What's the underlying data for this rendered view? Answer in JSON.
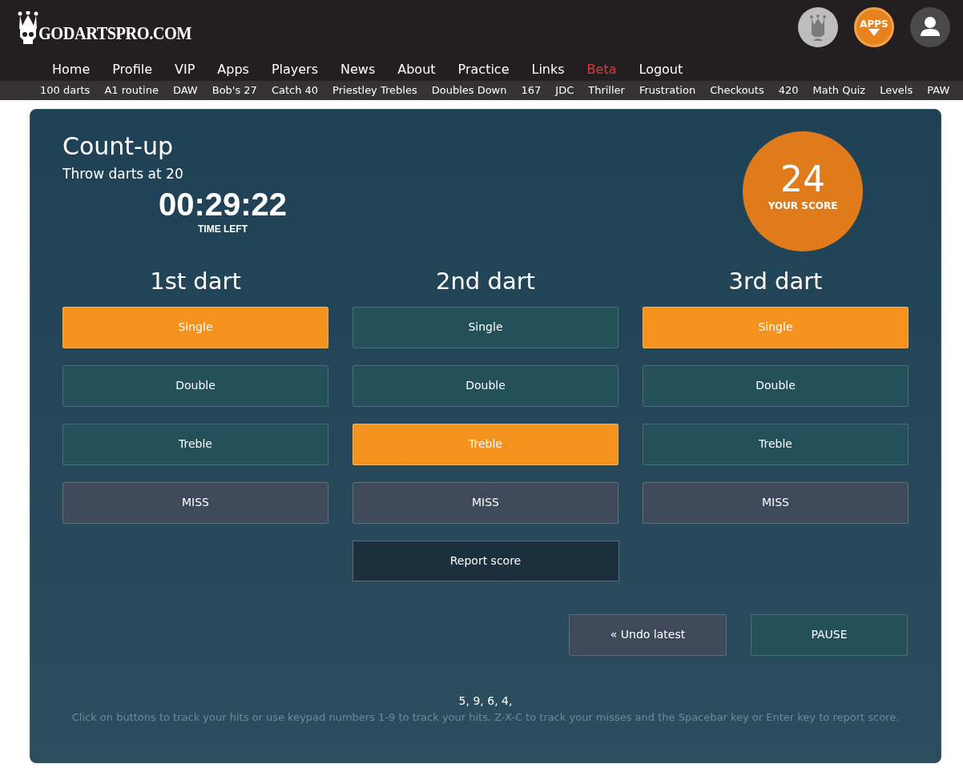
{
  "logo": {
    "text": "GODARTSPRO.COM"
  },
  "nav": [
    {
      "label": "Home",
      "color": "#ffffff"
    },
    {
      "label": "Profile",
      "color": "#ffffff"
    },
    {
      "label": "VIP",
      "color": "#ffffff"
    },
    {
      "label": "Apps",
      "color": "#ffffff"
    },
    {
      "label": "Players",
      "color": "#ffffff"
    },
    {
      "label": "News",
      "color": "#ffffff"
    },
    {
      "label": "About",
      "color": "#ffffff"
    },
    {
      "label": "Practice",
      "color": "#ffffff"
    },
    {
      "label": "Links",
      "color": "#ffffff"
    },
    {
      "label": "Beta",
      "color": "#e8333a"
    },
    {
      "label": "Logout",
      "color": "#ffffff"
    }
  ],
  "apps_badge": {
    "label": "APPS"
  },
  "subnav": [
    "100 darts",
    "A1 routine",
    "DAW",
    "Bob's 27",
    "Catch 40",
    "Priestley Trebles",
    "Doubles Down",
    "167",
    "JDC",
    "Thriller",
    "Frustration",
    "Checkouts",
    "420",
    "Math Quiz",
    "Levels",
    "PAW"
  ],
  "game": {
    "title": "Count-up",
    "subtitle": "Throw darts at 20",
    "timer": "00:29:22",
    "timer_label": "TIME LEFT",
    "score": "24",
    "score_label": "YOUR SCORE"
  },
  "darts": [
    {
      "heading": "1st dart",
      "options": [
        {
          "label": "Single",
          "kind": "hit",
          "selected": true
        },
        {
          "label": "Double",
          "kind": "hit",
          "selected": false
        },
        {
          "label": "Treble",
          "kind": "hit",
          "selected": false
        },
        {
          "label": "MISS",
          "kind": "miss",
          "selected": false
        }
      ]
    },
    {
      "heading": "2nd dart",
      "options": [
        {
          "label": "Single",
          "kind": "hit",
          "selected": false
        },
        {
          "label": "Double",
          "kind": "hit",
          "selected": false
        },
        {
          "label": "Treble",
          "kind": "hit",
          "selected": true
        },
        {
          "label": "MISS",
          "kind": "miss",
          "selected": false
        }
      ]
    },
    {
      "heading": "3rd dart",
      "options": [
        {
          "label": "Single",
          "kind": "hit",
          "selected": true
        },
        {
          "label": "Double",
          "kind": "hit",
          "selected": false
        },
        {
          "label": "Treble",
          "kind": "hit",
          "selected": false
        },
        {
          "label": "MISS",
          "kind": "miss",
          "selected": false
        }
      ]
    }
  ],
  "report_button": "Report score",
  "undo_button": "« Undo latest",
  "pause_button": "PAUSE",
  "history": "5, 9, 6, 4,",
  "help": "Click on buttons to track your hits or use keypad numbers 1-9 to track your hits, Z-X-C to track your misses and the Spacebar key or Enter key to report score."
}
